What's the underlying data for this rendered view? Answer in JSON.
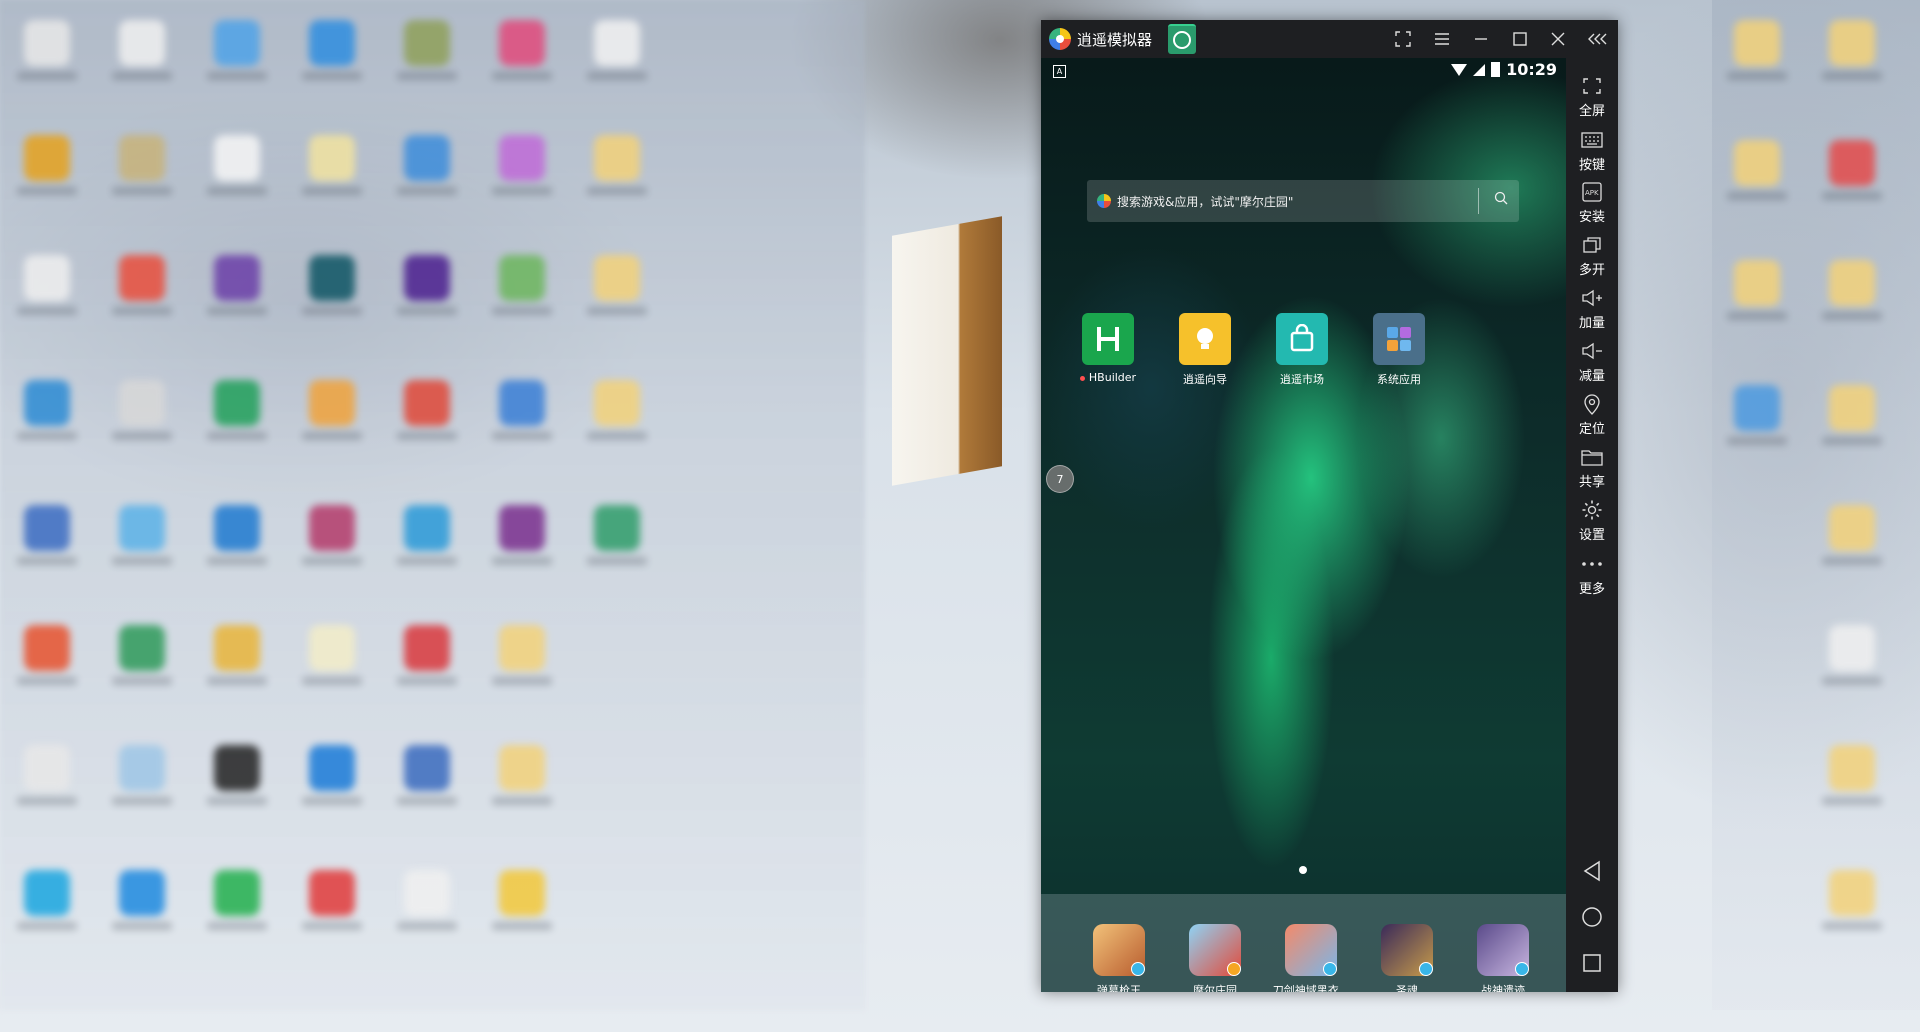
{
  "emulator": {
    "title": "逍遥模拟器",
    "time": "10:29",
    "search_placeholder": "搜索游戏&应用，试试\"摩尔庄园\"",
    "float_ball_text": "7",
    "apps": [
      {
        "label": "HBuilder",
        "color": "#1aa64d"
      },
      {
        "label": "逍遥向导",
        "color": "#f6c12b"
      },
      {
        "label": "逍遥市场",
        "color": "#23b9b0"
      },
      {
        "label": "系统应用",
        "color": "#4a6f8a"
      }
    ],
    "dock": [
      {
        "label": "弹幕枪王"
      },
      {
        "label": "摩尔庄园"
      },
      {
        "label": "刀剑神域黑衣..."
      },
      {
        "label": "圣魂"
      },
      {
        "label": "战神遗迹"
      }
    ],
    "sidebar": [
      {
        "label": "全屏",
        "icon": "fullscreen-icon"
      },
      {
        "label": "按键",
        "icon": "keyboard-icon"
      },
      {
        "label": "安装",
        "icon": "apk-install-icon"
      },
      {
        "label": "多开",
        "icon": "multi-instance-icon"
      },
      {
        "label": "加量",
        "icon": "volume-up-icon"
      },
      {
        "label": "减量",
        "icon": "volume-down-icon"
      },
      {
        "label": "定位",
        "icon": "location-icon"
      },
      {
        "label": "共享",
        "icon": "folder-icon"
      },
      {
        "label": "设置",
        "icon": "gear-icon"
      },
      {
        "label": "更多",
        "icon": "more-icon"
      }
    ]
  },
  "colors": {
    "window_bg": "#1e1f22",
    "tab_accent": "#2a9b6c"
  }
}
